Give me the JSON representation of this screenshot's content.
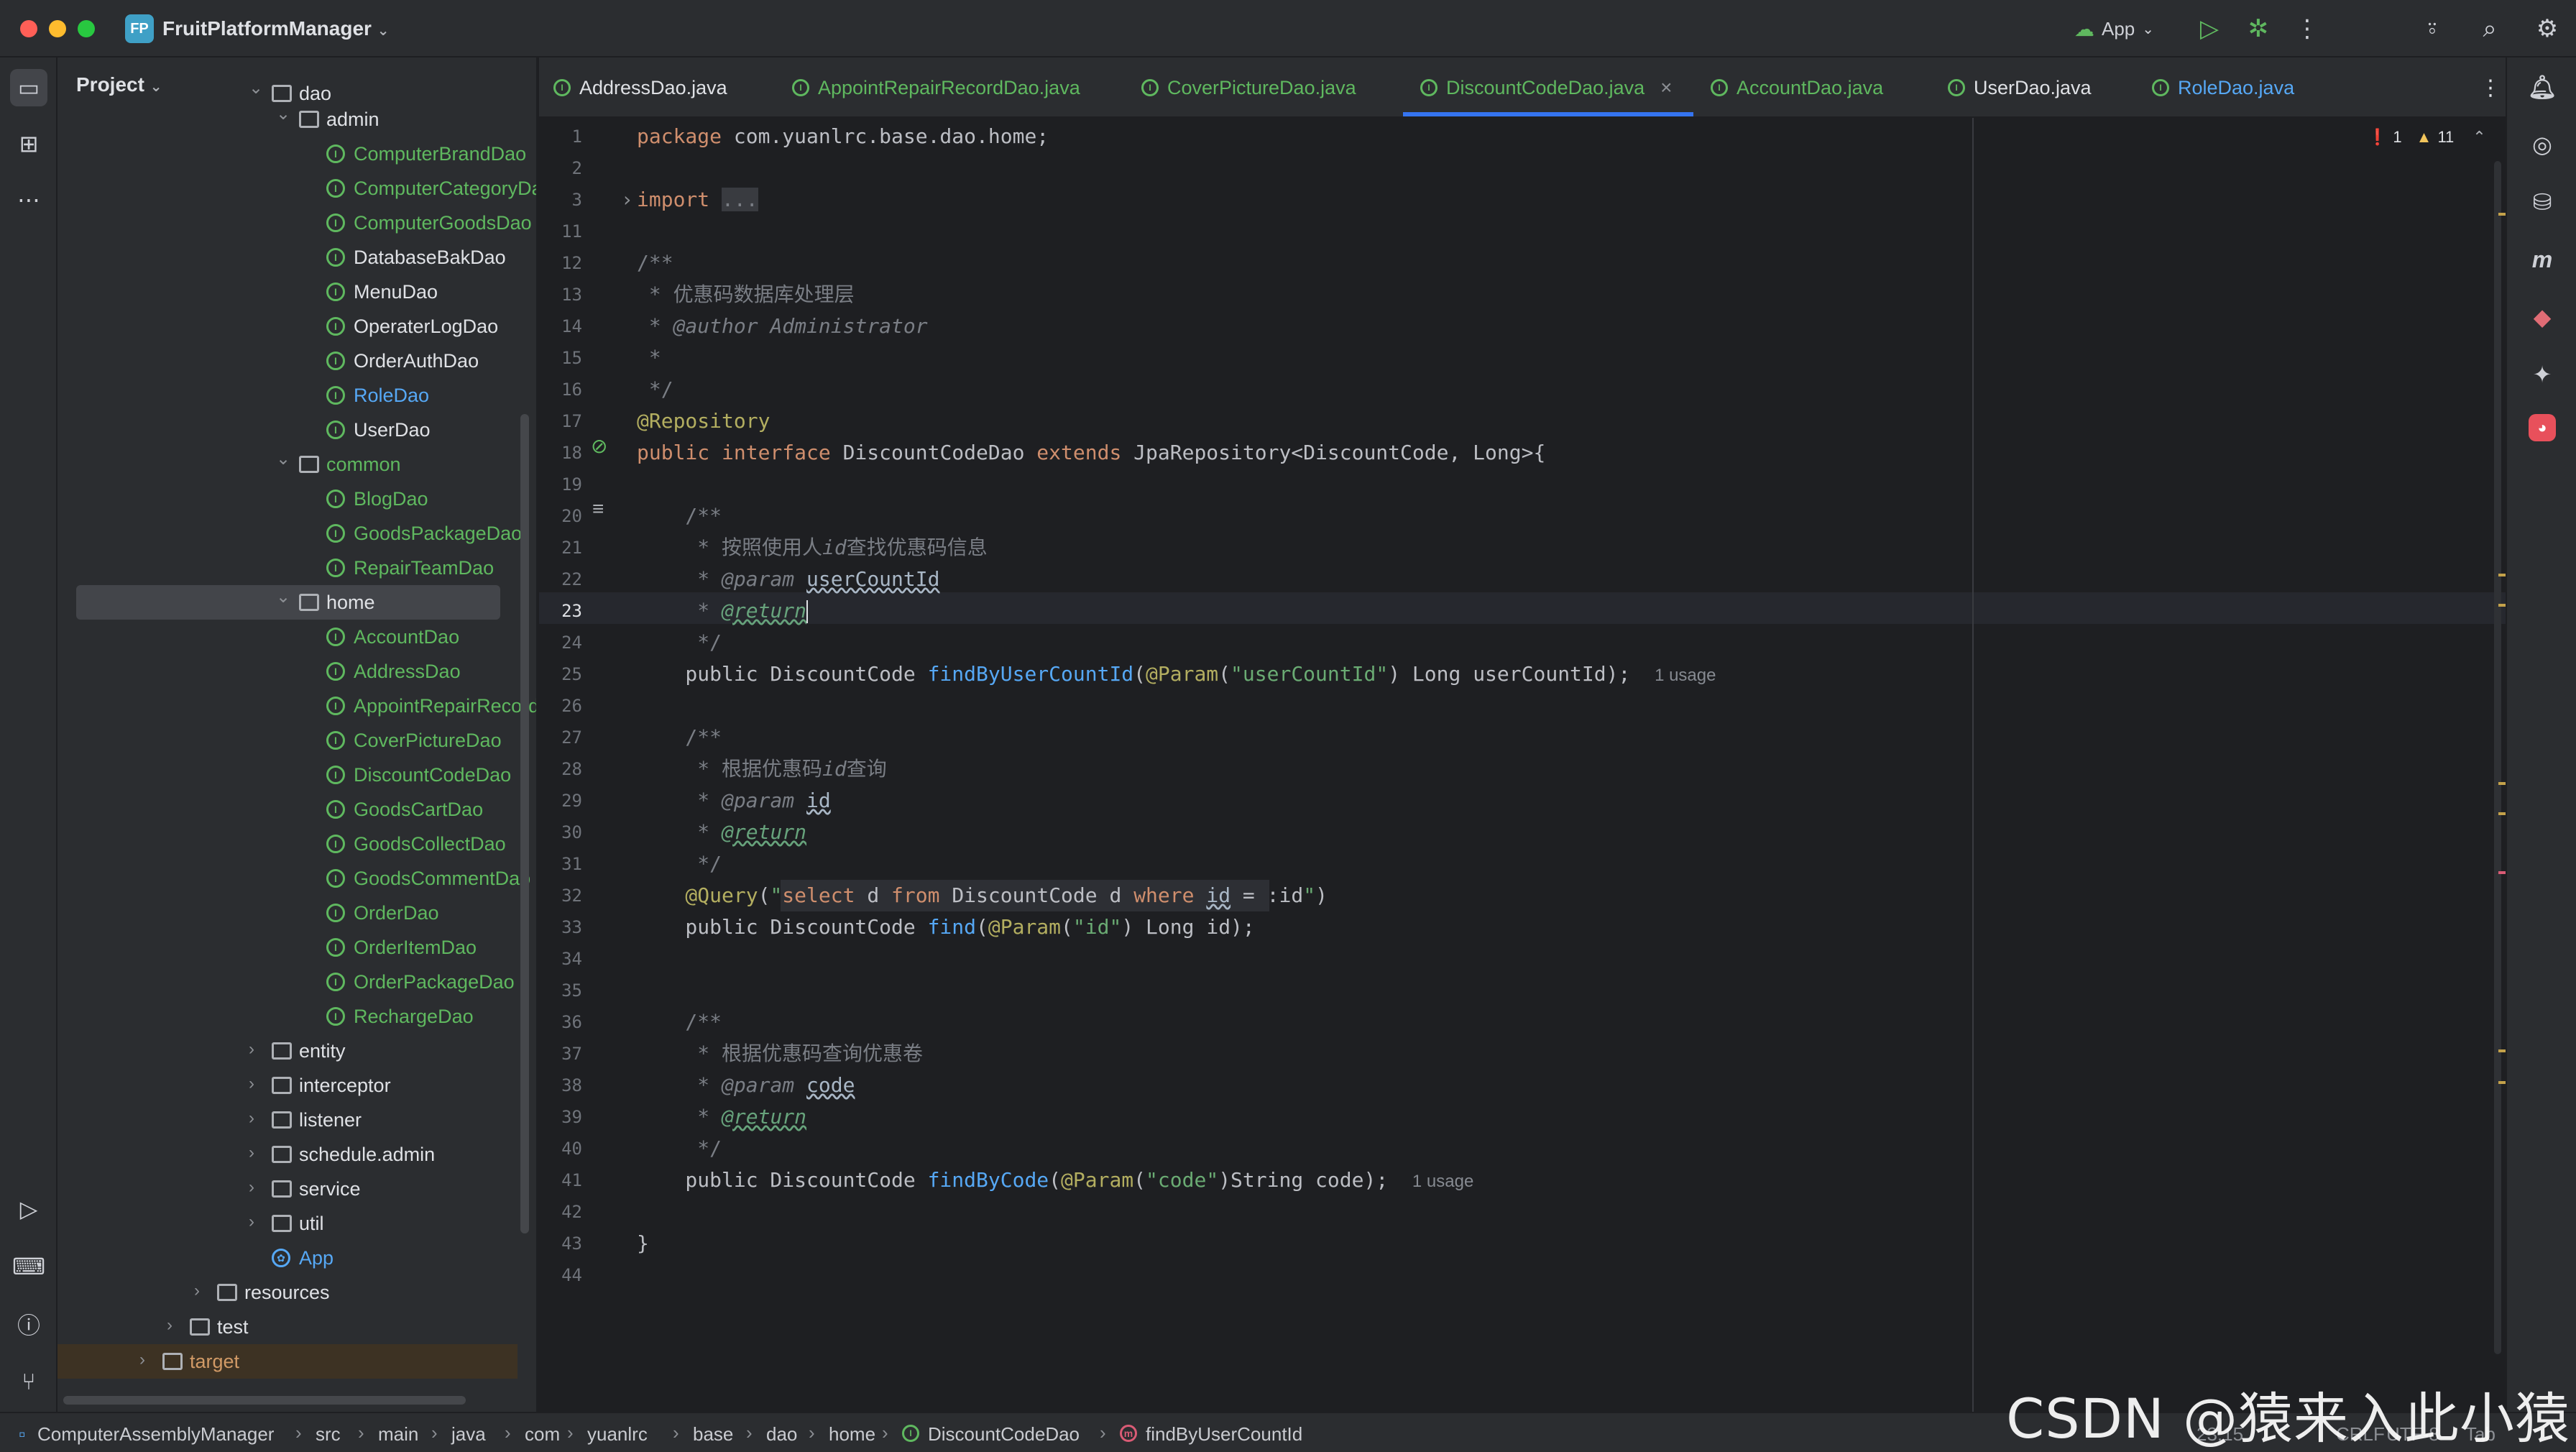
{
  "window": {
    "project_badge": "FP",
    "project_name": "FruitPlatformManager",
    "run_config": "App"
  },
  "panel": {
    "title": "Project"
  },
  "tree": [
    {
      "label": "dao",
      "kind": "folder",
      "depth": 3,
      "state": "open",
      "partial": true
    },
    {
      "label": "admin",
      "kind": "folder",
      "depth": 4,
      "state": "open"
    },
    {
      "label": "ComputerBrandDao",
      "kind": "iface",
      "depth": 5,
      "color": "#5fb85f"
    },
    {
      "label": "ComputerCategoryDa",
      "kind": "iface",
      "depth": 5,
      "color": "#5fb85f"
    },
    {
      "label": "ComputerGoodsDao",
      "kind": "iface",
      "depth": 5,
      "color": "#5fb85f"
    },
    {
      "label": "DatabaseBakDao",
      "kind": "iface",
      "depth": 5,
      "color": "#dfe1e5"
    },
    {
      "label": "MenuDao",
      "kind": "iface",
      "depth": 5,
      "color": "#dfe1e5"
    },
    {
      "label": "OperaterLogDao",
      "kind": "iface",
      "depth": 5,
      "color": "#dfe1e5"
    },
    {
      "label": "OrderAuthDao",
      "kind": "iface",
      "depth": 5,
      "color": "#dfe1e5"
    },
    {
      "label": "RoleDao",
      "kind": "iface",
      "depth": 5,
      "color": "#56a8f5"
    },
    {
      "label": "UserDao",
      "kind": "iface",
      "depth": 5,
      "color": "#dfe1e5"
    },
    {
      "label": "common",
      "kind": "folder",
      "depth": 4,
      "state": "open",
      "color": "#5fb85f"
    },
    {
      "label": "BlogDao",
      "kind": "iface",
      "depth": 5,
      "color": "#5fb85f"
    },
    {
      "label": "GoodsPackageDao",
      "kind": "iface",
      "depth": 5,
      "color": "#5fb85f"
    },
    {
      "label": "RepairTeamDao",
      "kind": "iface",
      "depth": 5,
      "color": "#5fb85f"
    },
    {
      "label": "home",
      "kind": "folder",
      "depth": 4,
      "state": "open",
      "selected": true
    },
    {
      "label": "AccountDao",
      "kind": "iface",
      "depth": 5,
      "color": "#5fb85f"
    },
    {
      "label": "AddressDao",
      "kind": "iface",
      "depth": 5,
      "color": "#5fb85f"
    },
    {
      "label": "AppointRepairRecordI",
      "kind": "iface",
      "depth": 5,
      "color": "#5fb85f"
    },
    {
      "label": "CoverPictureDao",
      "kind": "iface",
      "depth": 5,
      "color": "#5fb85f"
    },
    {
      "label": "DiscountCodeDao",
      "kind": "iface",
      "depth": 5,
      "color": "#5fb85f"
    },
    {
      "label": "GoodsCartDao",
      "kind": "iface",
      "depth": 5,
      "color": "#5fb85f"
    },
    {
      "label": "GoodsCollectDao",
      "kind": "iface",
      "depth": 5,
      "color": "#5fb85f"
    },
    {
      "label": "GoodsCommentDao",
      "kind": "iface",
      "depth": 5,
      "color": "#5fb85f"
    },
    {
      "label": "OrderDao",
      "kind": "iface",
      "depth": 5,
      "color": "#5fb85f"
    },
    {
      "label": "OrderItemDao",
      "kind": "iface",
      "depth": 5,
      "color": "#5fb85f"
    },
    {
      "label": "OrderPackageDao",
      "kind": "iface",
      "depth": 5,
      "color": "#5fb85f"
    },
    {
      "label": "RechargeDao",
      "kind": "iface",
      "depth": 5,
      "color": "#5fb85f"
    },
    {
      "label": "entity",
      "kind": "folder",
      "depth": 3,
      "state": "closed"
    },
    {
      "label": "interceptor",
      "kind": "folder",
      "depth": 3,
      "state": "closed"
    },
    {
      "label": "listener",
      "kind": "folder",
      "depth": 3,
      "state": "closed"
    },
    {
      "label": "schedule.admin",
      "kind": "folder",
      "depth": 3,
      "state": "closed"
    },
    {
      "label": "service",
      "kind": "folder",
      "depth": 3,
      "state": "closed"
    },
    {
      "label": "util",
      "kind": "folder",
      "depth": 3,
      "state": "closed"
    },
    {
      "label": "App",
      "kind": "app",
      "depth": 3,
      "color": "#56a8f5"
    },
    {
      "label": "resources",
      "kind": "folder",
      "depth": 1,
      "state": "closed"
    },
    {
      "label": "test",
      "kind": "folder",
      "depth": 0,
      "state": "closed"
    },
    {
      "label": "target",
      "kind": "folder",
      "depth": -1,
      "state": "closed",
      "partial": true,
      "color": "#d19a66"
    }
  ],
  "tabs": [
    {
      "label": "AddressDao.java",
      "color": "#dfe1e5"
    },
    {
      "label": "AppointRepairRecordDao.java",
      "color": "#5fb85f"
    },
    {
      "label": "CoverPictureDao.java",
      "color": "#5fb85f"
    },
    {
      "label": "DiscountCodeDao.java",
      "color": "#5fb85f",
      "active": true
    },
    {
      "label": "AccountDao.java",
      "color": "#5fb85f"
    },
    {
      "label": "UserDao.java",
      "color": "#dfe1e5"
    },
    {
      "label": "RoleDao.java",
      "color": "#56a8f5"
    }
  ],
  "tab_close": "×",
  "inspections": {
    "errors": "1",
    "warnings": "11"
  },
  "code": [
    {
      "n": "1",
      "t": [
        [
          "kw",
          "package "
        ],
        [
          "typ",
          "com.yuanlrc.base.dao.home;"
        ]
      ]
    },
    {
      "n": "2",
      "t": []
    },
    {
      "n": "3",
      "t": [
        [
          "kw",
          "import "
        ],
        [
          "cmt",
          "..."
        ]
      ]
    },
    {
      "n": "11",
      "t": []
    },
    {
      "n": "12",
      "t": [
        [
          "cmt",
          "/**"
        ]
      ]
    },
    {
      "n": "13",
      "t": [
        [
          "cmt",
          " * 优惠码数据库处理层"
        ]
      ]
    },
    {
      "n": "14",
      "t": [
        [
          "cmt",
          " * "
        ],
        [
          "cmti",
          "@author Administrator"
        ]
      ]
    },
    {
      "n": "15",
      "t": [
        [
          "cmt",
          " *"
        ]
      ]
    },
    {
      "n": "16",
      "t": [
        [
          "cmt",
          " */"
        ]
      ]
    },
    {
      "n": "17",
      "t": [
        [
          "ann",
          "@Repository"
        ]
      ]
    },
    {
      "n": "18",
      "t": [
        [
          "kw",
          "public interface "
        ],
        [
          "typ",
          "DiscountCodeDao "
        ],
        [
          "kw",
          "extends "
        ],
        [
          "typ",
          "JpaRepository<DiscountCode, Long>{"
        ]
      ]
    },
    {
      "n": "19",
      "t": []
    },
    {
      "n": "20",
      "t": [
        [
          "cmt",
          "    /**"
        ]
      ]
    },
    {
      "n": "21",
      "t": [
        [
          "cmt",
          "     * 按照使用人"
        ],
        [
          "cmti",
          "id"
        ],
        [
          "cmt",
          "查找优惠码信息"
        ]
      ]
    },
    {
      "n": "22",
      "t": [
        [
          "cmt",
          "     * "
        ],
        [
          "cmti",
          "@param "
        ],
        [
          "docparam",
          "userCountId"
        ]
      ]
    },
    {
      "n": "23",
      "t": [
        [
          "cmt",
          "     * "
        ],
        [
          "doctag",
          "@return"
        ]
      ]
    },
    {
      "n": "24",
      "t": [
        [
          "cmt",
          "     */"
        ]
      ]
    },
    {
      "n": "25",
      "t": [
        [
          "typ",
          "    public DiscountCode "
        ],
        [
          "fn",
          "findByUserCountId"
        ],
        [
          "typ",
          "("
        ],
        [
          "ann",
          "@Param"
        ],
        [
          "typ",
          "("
        ],
        [
          "str",
          "\"userCountId\""
        ],
        [
          "typ",
          ") Long userCountId);  "
        ],
        [
          "hint",
          "1 usage"
        ]
      ]
    },
    {
      "n": "26",
      "t": []
    },
    {
      "n": "27",
      "t": [
        [
          "cmt",
          "    /**"
        ]
      ]
    },
    {
      "n": "28",
      "t": [
        [
          "cmt",
          "     * 根据优惠码"
        ],
        [
          "cmti",
          "id"
        ],
        [
          "cmt",
          "查询"
        ]
      ]
    },
    {
      "n": "29",
      "t": [
        [
          "cmt",
          "     * "
        ],
        [
          "cmti",
          "@param "
        ],
        [
          "docparam",
          "id"
        ]
      ]
    },
    {
      "n": "30",
      "t": [
        [
          "cmt",
          "     * "
        ],
        [
          "doctag",
          "@return"
        ]
      ]
    },
    {
      "n": "31",
      "t": [
        [
          "cmt",
          "     */"
        ]
      ]
    },
    {
      "n": "32",
      "t": [
        [
          "ann",
          "    @Query"
        ],
        [
          "typ",
          "("
        ],
        [
          "str",
          "\""
        ],
        [
          "kw",
          "select "
        ],
        [
          "typ",
          "d "
        ],
        [
          "kw",
          "from "
        ],
        [
          "typ",
          "DiscountCode d "
        ],
        [
          "kw",
          "where "
        ],
        [
          "docparam",
          "id"
        ],
        [
          "typ",
          " = :id"
        ],
        [
          "str",
          "\""
        ],
        [
          "typ",
          ")"
        ]
      ]
    },
    {
      "n": "33",
      "t": [
        [
          "typ",
          "    public DiscountCode "
        ],
        [
          "fn",
          "find"
        ],
        [
          "typ",
          "("
        ],
        [
          "ann",
          "@Param"
        ],
        [
          "typ",
          "("
        ],
        [
          "str",
          "\"id\""
        ],
        [
          "typ",
          ") Long id);"
        ]
      ]
    },
    {
      "n": "34",
      "t": []
    },
    {
      "n": "35",
      "t": []
    },
    {
      "n": "36",
      "t": [
        [
          "cmt",
          "    /**"
        ]
      ]
    },
    {
      "n": "37",
      "t": [
        [
          "cmt",
          "     * 根据优惠码查询优惠卷"
        ]
      ]
    },
    {
      "n": "38",
      "t": [
        [
          "cmt",
          "     * "
        ],
        [
          "cmti",
          "@param "
        ],
        [
          "docparam",
          "code"
        ]
      ]
    },
    {
      "n": "39",
      "t": [
        [
          "cmt",
          "     * "
        ],
        [
          "doctag",
          "@return"
        ]
      ]
    },
    {
      "n": "40",
      "t": [
        [
          "cmt",
          "     */"
        ]
      ]
    },
    {
      "n": "41",
      "t": [
        [
          "typ",
          "    public DiscountCode "
        ],
        [
          "fn",
          "findByCode"
        ],
        [
          "typ",
          "("
        ],
        [
          "ann",
          "@Param"
        ],
        [
          "typ",
          "("
        ],
        [
          "str",
          "\"code\""
        ],
        [
          "typ",
          ")String code);  "
        ],
        [
          "hint",
          "1 usage"
        ]
      ]
    },
    {
      "n": "42",
      "t": []
    },
    {
      "n": "43",
      "t": [
        [
          "typ",
          "}"
        ]
      ]
    },
    {
      "n": "44",
      "t": []
    }
  ],
  "breadcrumbs": [
    "ComputerAssemblyManager",
    "src",
    "main",
    "java",
    "com",
    "yuanlrc",
    "base",
    "dao",
    "home",
    "DiscountCodeDao",
    "findByUserCountId"
  ],
  "status": {
    "position": "23:15",
    "line_sep": "CRLF",
    "encoding": "UTF-8",
    "indent": "Tab"
  },
  "watermark": "CSDN @猿来入此小猿"
}
